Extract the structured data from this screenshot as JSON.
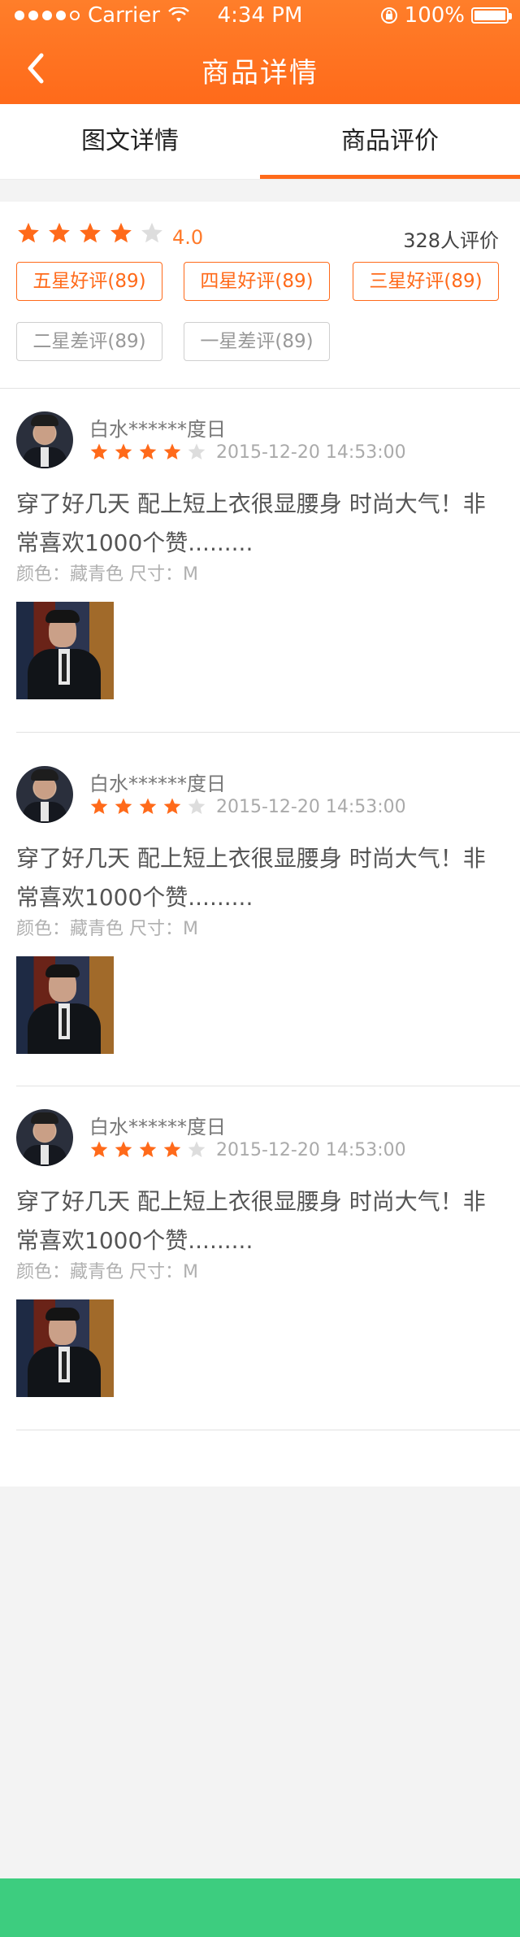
{
  "status_bar": {
    "carrier": "Carrier",
    "time": "4:34 PM",
    "battery": "100%"
  },
  "header": {
    "title": "商品详情",
    "back_icon": "chevron-left-icon"
  },
  "tabs": [
    {
      "label": "图文详情",
      "active": false
    },
    {
      "label": "商品评价",
      "active": true
    }
  ],
  "summary": {
    "rating": 4,
    "score_text": "4.0",
    "count_text": "328人评价"
  },
  "filters": [
    {
      "label": "五星好评(89)",
      "active": true
    },
    {
      "label": "四星好评(89)",
      "active": true
    },
    {
      "label": "三星好评(89)",
      "active": true
    },
    {
      "label": "二星差评(89)",
      "active": false
    },
    {
      "label": "一星差评(89)",
      "active": false
    }
  ],
  "reviews": [
    {
      "user": "白水******度日",
      "rating": 4,
      "date": "2015-12-20 14:53:00",
      "text": "穿了好几天 配上短上衣很显腰身 时尚大气！非常喜欢1000个赞.........",
      "spec": "颜色：藏青色   尺寸：M"
    },
    {
      "user": "白水******度日",
      "rating": 4,
      "date": "2015-12-20 14:53:00",
      "text": "穿了好几天 配上短上衣很显腰身 时尚大气！非常喜欢1000个赞.........",
      "spec": "颜色：藏青色   尺寸：M"
    },
    {
      "user": "白水******度日",
      "rating": 4,
      "date": "2015-12-20 14:53:00",
      "text": "穿了好几天 配上短上衣很显腰身 时尚大气！非常喜欢1000个赞.........",
      "spec": "颜色：藏青色   尺寸：M"
    }
  ],
  "colors": {
    "accent": "#ff6a1a",
    "star_empty": "#dddddd",
    "bottom_bar": "#3dcd7f"
  }
}
